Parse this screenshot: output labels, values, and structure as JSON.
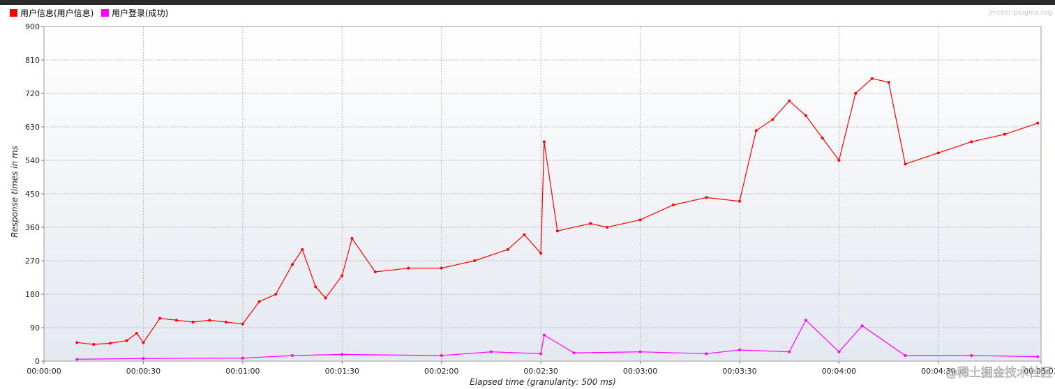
{
  "watermark": "jmeter-plugins.org",
  "credit": "@稀土掘金技术社区",
  "chart_data": {
    "type": "line",
    "xlabel": "Elapsed time (granularity: 500 ms)",
    "ylabel": "Response times in ms",
    "ylim": [
      0,
      900
    ],
    "yticks": [
      0,
      90,
      180,
      270,
      360,
      450,
      540,
      630,
      720,
      810,
      900
    ],
    "xlim": [
      "00:00:00",
      "00:05:01"
    ],
    "xticks": [
      "00:00:00",
      "00:00:30",
      "00:01:00",
      "00:01:30",
      "00:02:00",
      "00:02:30",
      "00:03:00",
      "00:03:30",
      "00:04:00",
      "00:04:30",
      "00:05:01"
    ],
    "grid": true,
    "legend_position": "top-left",
    "series": [
      {
        "name": "用户信息(用户信息)",
        "color": "#ff0000",
        "x": [
          "00:00:10",
          "00:00:15",
          "00:00:20",
          "00:00:25",
          "00:00:28",
          "00:00:30",
          "00:00:35",
          "00:00:40",
          "00:00:45",
          "00:00:50",
          "00:00:55",
          "00:01:00",
          "00:01:05",
          "00:01:10",
          "00:01:15",
          "00:01:18",
          "00:01:22",
          "00:01:25",
          "00:01:30",
          "00:01:33",
          "00:01:40",
          "00:01:50",
          "00:02:00",
          "00:02:10",
          "00:02:20",
          "00:02:25",
          "00:02:30",
          "00:02:31",
          "00:02:35",
          "00:02:45",
          "00:02:50",
          "00:03:00",
          "00:03:10",
          "00:03:20",
          "00:03:30",
          "00:03:35",
          "00:03:40",
          "00:03:45",
          "00:03:50",
          "00:03:55",
          "00:04:00",
          "00:04:05",
          "00:04:10",
          "00:04:15",
          "00:04:20",
          "00:04:30",
          "00:04:40",
          "00:04:50",
          "00:05:00"
        ],
        "values": [
          50,
          45,
          48,
          55,
          75,
          50,
          115,
          110,
          105,
          110,
          105,
          100,
          160,
          180,
          260,
          300,
          200,
          170,
          230,
          330,
          240,
          250,
          250,
          270,
          300,
          340,
          290,
          590,
          350,
          370,
          360,
          380,
          420,
          440,
          430,
          620,
          650,
          700,
          660,
          600,
          540,
          720,
          760,
          750,
          530,
          560,
          590,
          610,
          640
        ]
      },
      {
        "name": "用户登录(成功)",
        "color": "#ff00ff",
        "x": [
          "00:00:10",
          "00:00:30",
          "00:01:00",
          "00:01:15",
          "00:01:30",
          "00:02:00",
          "00:02:15",
          "00:02:30",
          "00:02:31",
          "00:02:40",
          "00:03:00",
          "00:03:20",
          "00:03:30",
          "00:03:45",
          "00:03:50",
          "00:04:00",
          "00:04:07",
          "00:04:20",
          "00:04:40",
          "00:05:00"
        ],
        "values": [
          5,
          7,
          8,
          15,
          18,
          15,
          25,
          20,
          70,
          22,
          25,
          20,
          30,
          25,
          110,
          25,
          95,
          15,
          15,
          12
        ]
      }
    ]
  }
}
